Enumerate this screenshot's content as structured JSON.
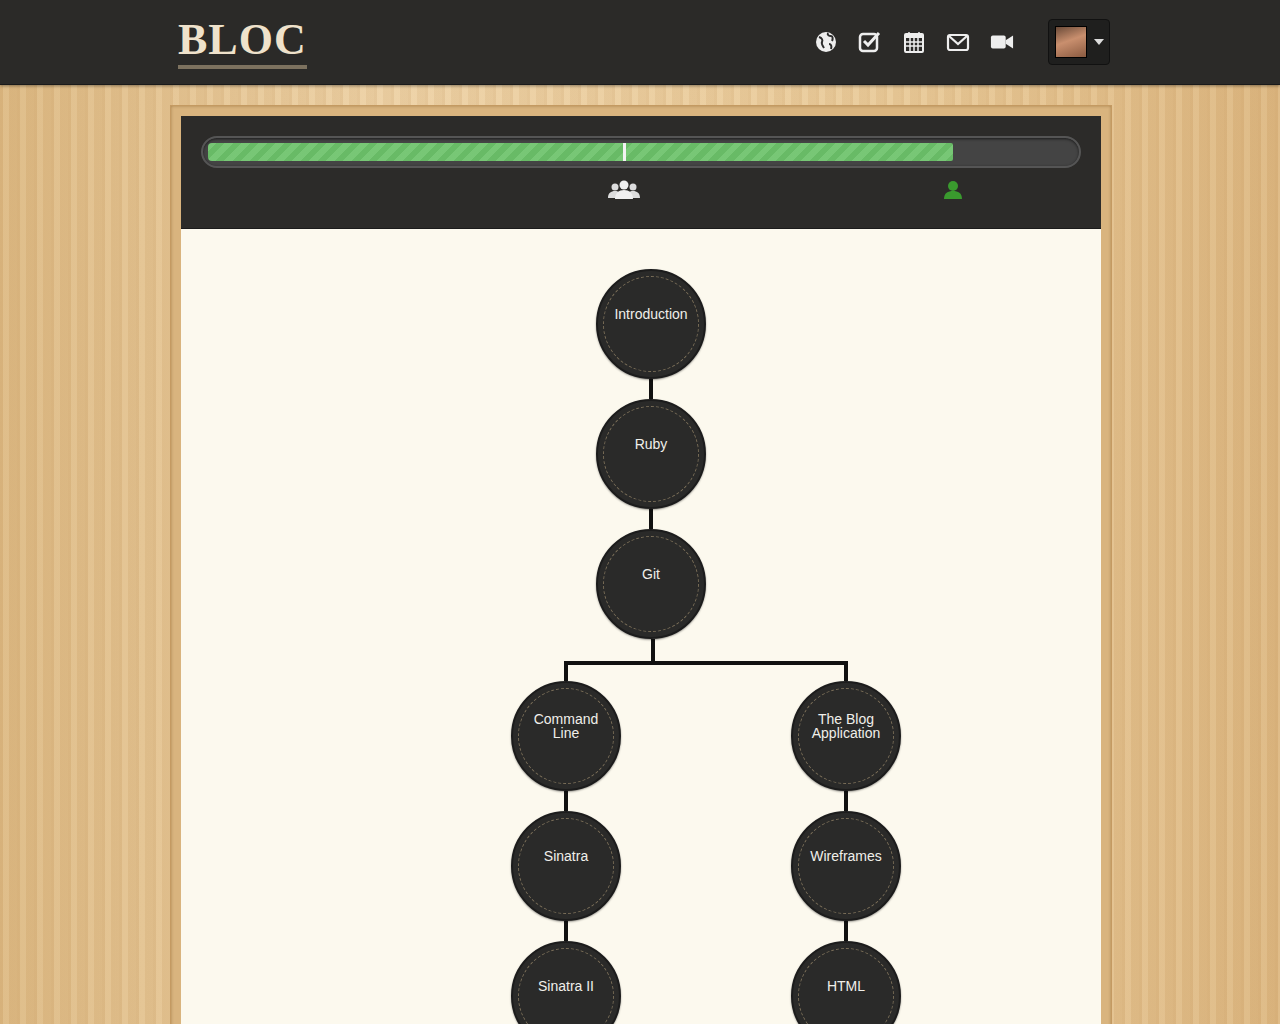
{
  "header": {
    "logo": "BLOC"
  },
  "progress": {
    "level": 0.86,
    "milestone": 0.48
  },
  "roadmap": {
    "trunk": [
      "Introduction",
      "Ruby",
      "Git"
    ],
    "branches": [
      [
        "Command Line",
        "Sinatra",
        "Sinatra II"
      ],
      [
        "The Blog Application",
        "Wireframes",
        "HTML"
      ]
    ]
  }
}
